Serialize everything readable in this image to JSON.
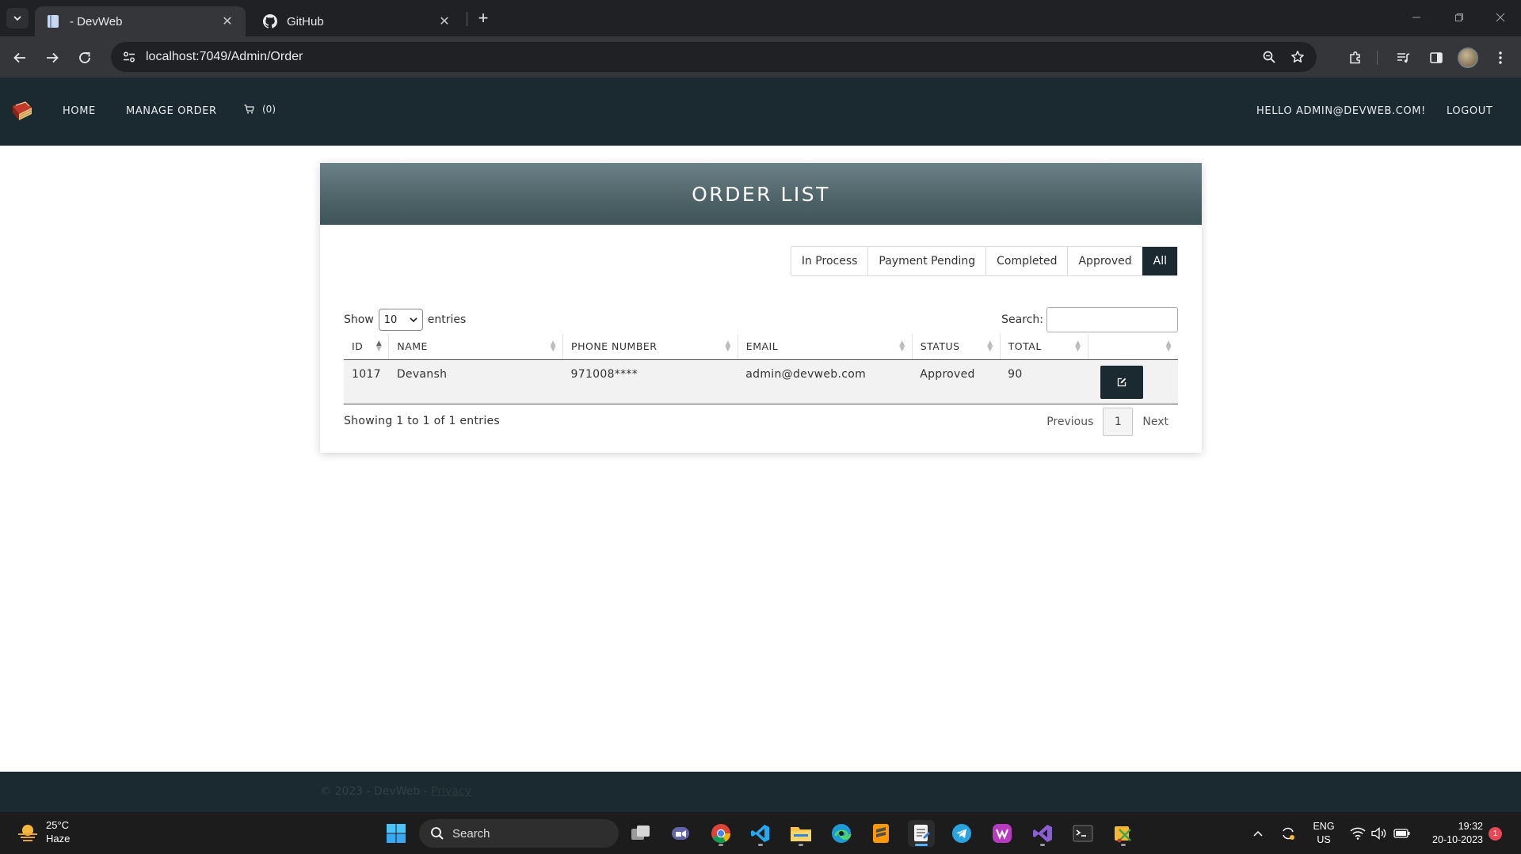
{
  "browser": {
    "tabs": [
      {
        "title": "- DevWeb",
        "favicon": "page-icon",
        "active": true
      },
      {
        "title": "GitHub",
        "favicon": "github-icon",
        "active": false
      }
    ],
    "url": "localhost:7049/Admin/Order"
  },
  "nav": {
    "home": "HOME",
    "manage_order": "MANAGE ORDER",
    "cart_count": "(0)",
    "hello": "HELLO ADMIN@DEVWEB.COM!",
    "logout": "LOGOUT"
  },
  "card": {
    "title": "ORDER LIST"
  },
  "filters": [
    {
      "label": "In Process",
      "active": false
    },
    {
      "label": "Payment Pending",
      "active": false
    },
    {
      "label": "Completed",
      "active": false
    },
    {
      "label": "Approved",
      "active": false
    },
    {
      "label": "All",
      "active": true
    }
  ],
  "datatable": {
    "show_label": "Show",
    "entries_value": "10",
    "entries_label": "entries",
    "search_label": "Search:",
    "search_value": "",
    "columns": [
      "ID",
      "NAME",
      "PHONE NUMBER",
      "EMAIL",
      "STATUS",
      "TOTAL",
      ""
    ],
    "sorted_column": "ID",
    "rows": [
      {
        "id": "1017",
        "name": "Devansh",
        "phone": "971008****",
        "email": "admin@devweb.com",
        "status": "Approved",
        "total": "90"
      }
    ],
    "info": "Showing 1 to 1 of 1 entries",
    "pagination": {
      "previous": "Previous",
      "current": "1",
      "next": "Next"
    }
  },
  "footer": {
    "copyright": "© 2023 - DevWeb -",
    "privacy": "Privacy"
  },
  "taskbar": {
    "weather_temp": "25°C",
    "weather_desc": "Haze",
    "search_label": "Search",
    "lang_line1": "ENG",
    "lang_line2": "US",
    "time": "19:32",
    "date": "20-10-2023",
    "notification_count": "1"
  },
  "colors": {
    "nav_bg": "#1b2a30",
    "header_gradient_top": "#6a8187",
    "header_gradient_bottom": "#3f5458",
    "active_filter": "#1b2a30"
  }
}
